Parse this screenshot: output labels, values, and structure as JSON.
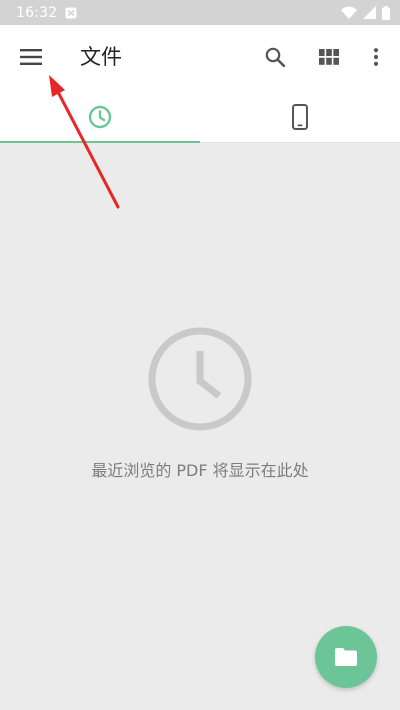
{
  "status_bar": {
    "time": "16:32"
  },
  "app_bar": {
    "title": "文件",
    "icons": [
      "menu-icon",
      "search-icon",
      "grid-view-icon",
      "more-vert-icon"
    ]
  },
  "tabs": [
    {
      "icon": "clock-icon",
      "selected": true
    },
    {
      "icon": "phone-icon",
      "selected": false
    }
  ],
  "empty_state": {
    "icon": "clock-icon",
    "message": "最近浏览的 PDF 将显示在此处"
  },
  "fab": {
    "icon": "folder-icon"
  },
  "colors": {
    "accent": "#6cc596",
    "status_bar": "#d3d3d3",
    "content_bg": "#ebebeb",
    "annotation_arrow": "#e8262a"
  }
}
